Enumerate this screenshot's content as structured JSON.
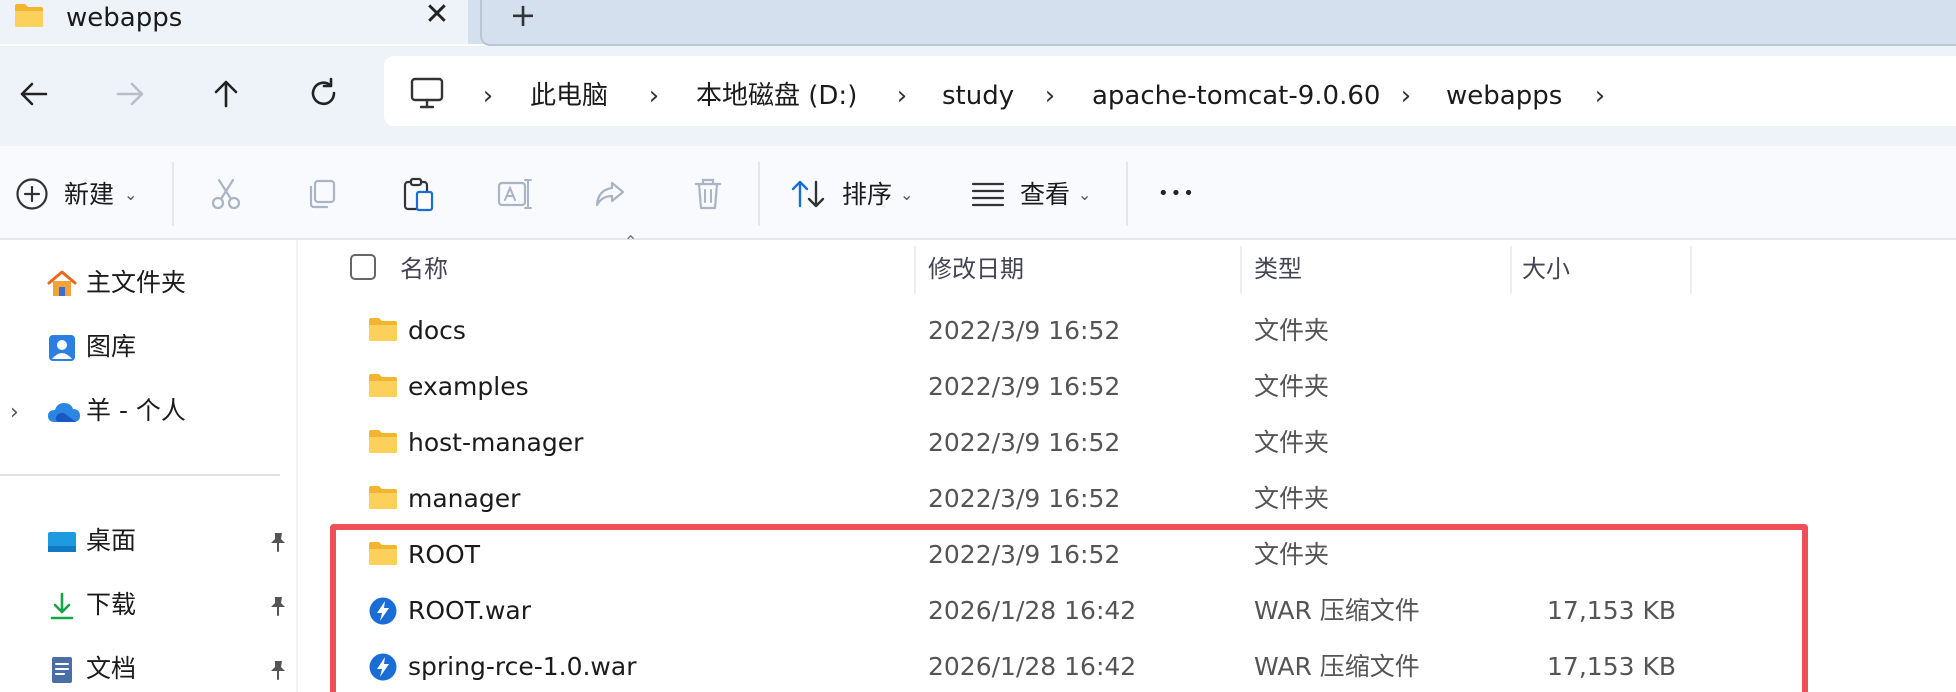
{
  "tab": {
    "title": "webapps",
    "close_glyph": "✕",
    "new_glyph": "+"
  },
  "breadcrumb": [
    "此电脑",
    "本地磁盘 (D:)",
    "study",
    "apache-tomcat-9.0.60",
    "webapps"
  ],
  "toolbar": {
    "new_label": "新建",
    "sort_label": "排序",
    "view_label": "查看",
    "more_glyph": "•••"
  },
  "sidebar": {
    "quick": [
      {
        "label": "主文件夹",
        "icon": "home-icon"
      },
      {
        "label": "图库",
        "icon": "gallery-icon"
      },
      {
        "label": "羊 - 个人",
        "icon": "onedrive-icon"
      }
    ],
    "pinned": [
      {
        "label": "桌面",
        "icon": "desktop-icon"
      },
      {
        "label": "下载",
        "icon": "download-icon"
      },
      {
        "label": "文档",
        "icon": "document-icon"
      }
    ]
  },
  "columns": {
    "name": "名称",
    "modified": "修改日期",
    "type": "类型",
    "size": "大小"
  },
  "files": [
    {
      "name": "docs",
      "modified": "2022/3/9 16:52",
      "type": "文件夹",
      "size": "",
      "icon": "folder-icon"
    },
    {
      "name": "examples",
      "modified": "2022/3/9 16:52",
      "type": "文件夹",
      "size": "",
      "icon": "folder-icon"
    },
    {
      "name": "host-manager",
      "modified": "2022/3/9 16:52",
      "type": "文件夹",
      "size": "",
      "icon": "folder-icon"
    },
    {
      "name": "manager",
      "modified": "2022/3/9 16:52",
      "type": "文件夹",
      "size": "",
      "icon": "folder-icon"
    },
    {
      "name": "ROOT",
      "modified": "2022/3/9 16:52",
      "type": "文件夹",
      "size": "",
      "icon": "folder-icon"
    },
    {
      "name": "ROOT.war",
      "modified": "2026/1/28 16:42",
      "type": "WAR 压缩文件",
      "size": "17,153 KB",
      "icon": "war-file-icon"
    },
    {
      "name": "spring-rce-1.0.war",
      "modified": "2026/1/28 16:42",
      "type": "WAR 压缩文件",
      "size": "17,153 KB",
      "icon": "war-file-icon"
    }
  ],
  "colors": {
    "accent": "#1a6dd6",
    "folder": "#f8c44a",
    "highlight": "#ef5055"
  }
}
